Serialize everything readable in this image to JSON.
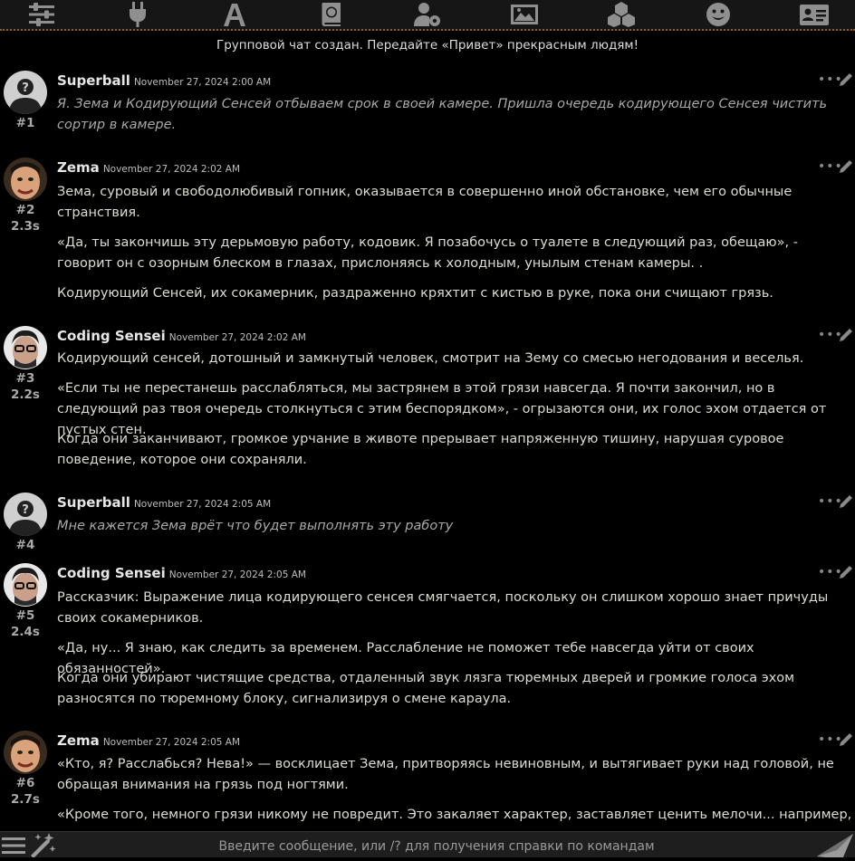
{
  "toolbar": {
    "icons": [
      "sliders-icon",
      "plug-icon",
      "font-icon",
      "book-globe-icon",
      "user-cog-icon",
      "image-icon",
      "cubes-icon",
      "smile-icon",
      "id-card-icon"
    ]
  },
  "system_message": "Групповой чат создан. Передайте «Привет» прекрасным людям!",
  "messages": [
    {
      "author": "Superball",
      "date": "November 27, 2024 2:00 AM",
      "number": "#1",
      "gen_time": "",
      "paragraphs": [
        "Я. Зема и Кодирующий Сенсей отбываем срок в своей камере. Пришла очередь кодирующего Сенсея чистить сортир в камере."
      ]
    },
    {
      "author": "Zema",
      "date": "November 27, 2024 2:02 AM",
      "number": "#2",
      "gen_time": "2.3s",
      "paragraphs": [
        "Зема, суровый и свободолюбивый гопник, оказывается в совершенно иной обстановке, чем его обычные странствия.",
        "«Да, ты закончишь эту дерьмовую работу, кодовик. Я позабочусь о туалете в следующий раз, обещаю», - говорит он с озорным блеском в глазах, прислоняясь к холодным, унылым стенам камеры. .",
        "Кодирующий Сенсей, их сокамерник, раздраженно кряхтит с кистью в руке, пока они счищают грязь."
      ]
    },
    {
      "author": "Coding Sensei",
      "date": "November 27, 2024 2:02 AM",
      "number": "#3",
      "gen_time": "2.2s",
      "paragraphs": [
        "Кодирующий сенсей, дотошный и замкнутый человек, смотрит на Зему со смесью негодования и веселья.",
        "«Если ты не перестанешь расслабляться, мы застрянем в этой грязи навсегда. Я почти закончил, но в следующий раз твоя очередь столкнуться с этим беспорядком», - огрызаются они, их голос эхом отдается от пустых стен.",
        "Когда они заканчивают, громкое урчание в животе прерывает напряженную тишину, нарушая суровое поведение, которое они сохраняли."
      ]
    },
    {
      "author": "Superball",
      "date": "November 27, 2024 2:05 AM",
      "number": "#4",
      "gen_time": "",
      "paragraphs": [
        "Мне кажется Зема врёт что будет выполнять эту работу"
      ]
    },
    {
      "author": "Coding Sensei",
      "date": "November 27, 2024 2:05 AM",
      "number": "#5",
      "gen_time": "2.4s",
      "paragraphs": [
        "Рассказчик: Выражение лица кодирующего сенсея смягчается, поскольку он слишком хорошо знает причуды своих сокамерников.",
        "«Да, ну... Я знаю, как следить за временем. Расслабление не поможет тебе навсегда уйти от своих обязанностей».",
        "Когда они убирают чистящие средства, отдаленный звук лязга тюремных дверей и громкие голоса эхом разносятся по тюремному блоку, сигнализируя о смене караула."
      ]
    },
    {
      "author": "Zema",
      "date": "November 27, 2024 2:05 AM",
      "number": "#6",
      "gen_time": "2.7s",
      "paragraphs": [
        "«Кто, я? Расслабься? Нева!» — восклицает Зема, притворяясь невиновным, и вытягивает руки над головой, не обращая внимания на грязь под ногтями.",
        "«Кроме того, немного грязи никому не повредит. Это закаляет характер, заставляет ценить мелочи... например,"
      ]
    }
  ],
  "input": {
    "placeholder": "Введите сообщение, или /? для получения справки по командам"
  }
}
